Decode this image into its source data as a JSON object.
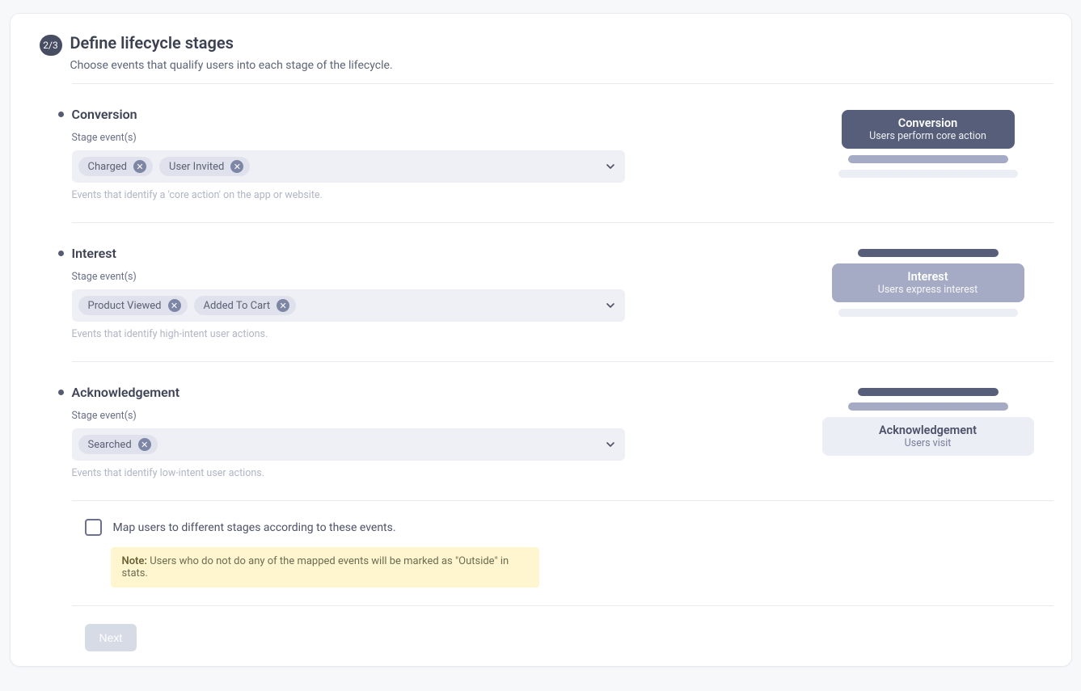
{
  "header": {
    "step": "2/3",
    "title": "Define lifecycle stages",
    "subtitle": "Choose events that qualify users into each stage of the lifecycle."
  },
  "stages": {
    "conversion": {
      "title": "Conversion",
      "field_label": "Stage event(s)",
      "chips": [
        "Charged",
        "User Invited"
      ],
      "help": "Events that identify a 'core action' on the app or website.",
      "graphic": {
        "title": "Conversion",
        "subtitle": "Users perform core action"
      }
    },
    "interest": {
      "title": "Interest",
      "field_label": "Stage event(s)",
      "chips": [
        "Product Viewed",
        "Added To Cart"
      ],
      "help": "Events that identify high-intent user actions.",
      "graphic": {
        "title": "Interest",
        "subtitle": "Users express interest"
      }
    },
    "acknowledgement": {
      "title": "Acknowledgement",
      "field_label": "Stage event(s)",
      "chips": [
        "Searched"
      ],
      "help": "Events that identify low-intent user actions.",
      "graphic": {
        "title": "Acknowledgement",
        "subtitle": "Users visit"
      }
    }
  },
  "map_checkbox_label": "Map users to different stages according to these events.",
  "note": {
    "prefix": "Note:",
    "text": " Users who do not do any of the mapped events will be marked as \"Outside\" in stats."
  },
  "next_button": "Next"
}
